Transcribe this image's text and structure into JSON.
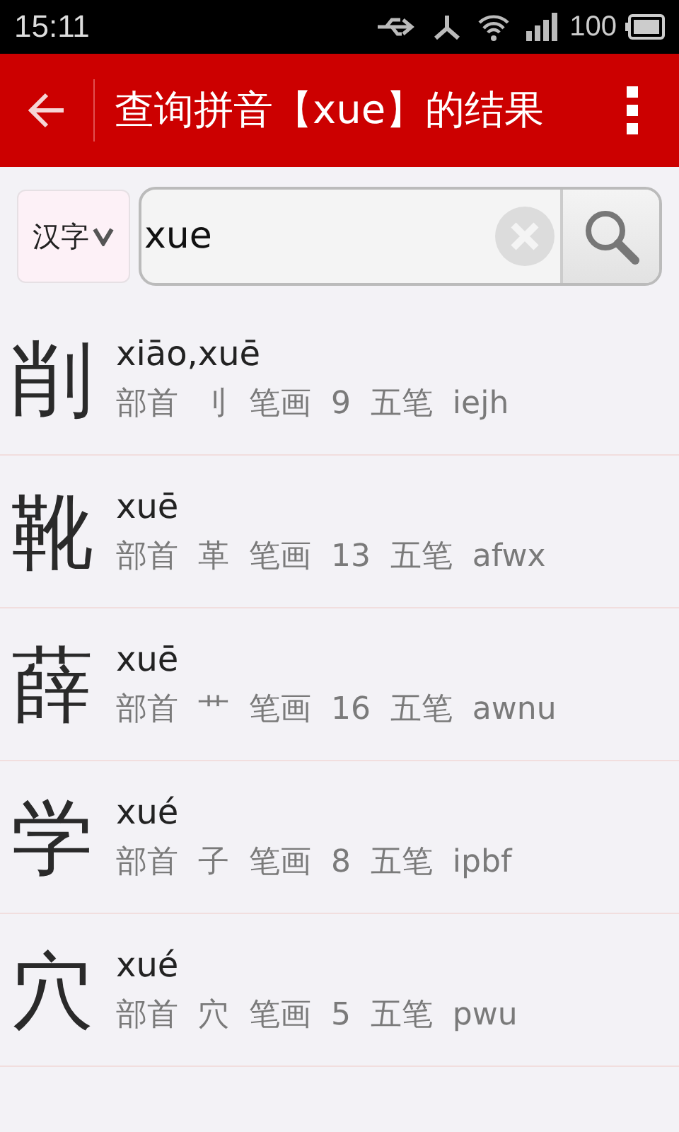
{
  "status_bar": {
    "time": "15:11",
    "battery": "100"
  },
  "app_bar": {
    "title": "查询拼音【xue】的结果"
  },
  "search": {
    "mode": "汉字",
    "value": "xue"
  },
  "results": [
    {
      "character": "削",
      "pinyin": "xiāo,xuē",
      "details": "部首  刂  笔画  9  五笔  iejh"
    },
    {
      "character": "靴",
      "pinyin": "xuē",
      "details": "部首  革  笔画  13  五笔  afwx"
    },
    {
      "character": "薛",
      "pinyin": "xuē",
      "details": "部首  艹  笔画  16  五笔  awnu"
    },
    {
      "character": "学",
      "pinyin": "xué",
      "details": "部首  子  笔画  8  五笔  ipbf"
    },
    {
      "character": "穴",
      "pinyin": "xué",
      "details": "部首  穴  笔画  5  五笔  pwu"
    }
  ]
}
